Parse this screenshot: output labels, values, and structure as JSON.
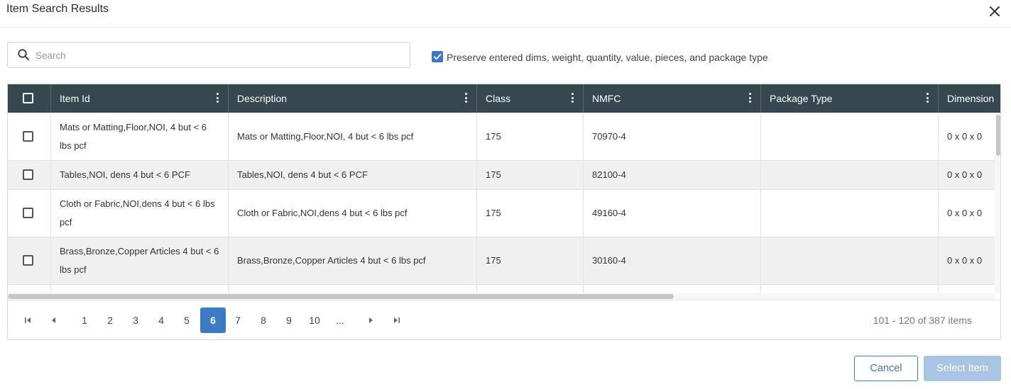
{
  "dialog": {
    "title": "Item Search Results"
  },
  "search": {
    "placeholder": "Search",
    "value": ""
  },
  "preserve": {
    "checked": true,
    "label": "Preserve entered dims, weight, quantity, value, pieces, and package type"
  },
  "grid": {
    "columns": [
      {
        "key": "item_id",
        "label": "Item Id"
      },
      {
        "key": "description",
        "label": "Description"
      },
      {
        "key": "class",
        "label": "Class"
      },
      {
        "key": "nmfc",
        "label": "NMFC"
      },
      {
        "key": "package_type",
        "label": "Package Type"
      },
      {
        "key": "dimension",
        "label": "Dimension"
      }
    ],
    "rows": [
      {
        "item_id": "Mats or Matting,Floor,NOI, 4 but < 6 lbs pcf",
        "description": "Mats or Matting,Floor,NOI, 4 but < 6 lbs pcf",
        "class": "175",
        "nmfc": "70970-4",
        "package_type": "",
        "dimension": "0 x 0 x 0"
      },
      {
        "item_id": "Tables,NOI, dens 4 but < 6 PCF",
        "description": "Tables,NOI, dens 4 but < 6 PCF",
        "class": "175",
        "nmfc": "82100-4",
        "package_type": "",
        "dimension": "0 x 0 x 0"
      },
      {
        "item_id": "Cloth or Fabric,NOI,dens 4 but < 6 lbs pcf",
        "description": "Cloth or Fabric,NOI,dens 4 but < 6 lbs pcf",
        "class": "175",
        "nmfc": "49160-4",
        "package_type": "",
        "dimension": "0 x 0 x 0"
      },
      {
        "item_id": "Brass,Bronze,Copper Articles 4 but < 6 lbs pcf",
        "description": "Brass,Bronze,Copper Articles 4 but < 6 lbs pcf",
        "class": "175",
        "nmfc": "30160-4",
        "package_type": "",
        "dimension": "0 x 0 x 0"
      },
      {
        "item_id": "",
        "description": "",
        "class": "",
        "nmfc": "",
        "package_type": "",
        "dimension": ""
      }
    ]
  },
  "pager": {
    "pages": [
      "1",
      "2",
      "3",
      "4",
      "5",
      "6",
      "7",
      "8",
      "9",
      "10",
      "..."
    ],
    "current_page": "6",
    "info": "101 - 120 of 387 items"
  },
  "buttons": {
    "cancel": "Cancel",
    "select": "Select Item"
  },
  "colors": {
    "header_bg": "#37474f",
    "accent": "#3d7cc4",
    "checkbox": "#3b78c2",
    "row_alt": "#f0f0f0",
    "select_disabled": "#a9c4e4"
  },
  "icons": [
    "close-icon",
    "search-icon",
    "checkbox-checked-icon",
    "kebab-menu-icon",
    "first-page-icon",
    "prev-page-icon",
    "next-page-icon",
    "last-page-icon"
  ]
}
